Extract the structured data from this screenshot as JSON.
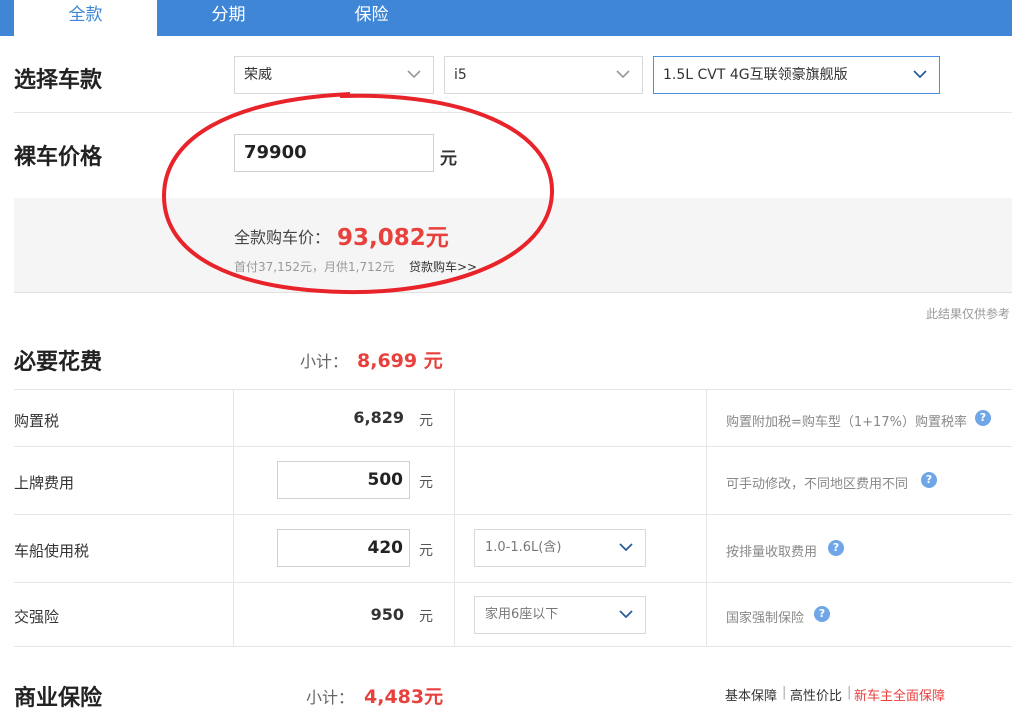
{
  "tabs": [
    {
      "label": "全款",
      "active": true
    },
    {
      "label": "分期",
      "active": false
    },
    {
      "label": "保险",
      "active": false
    }
  ],
  "select_car": {
    "title": "选择车款",
    "brand": "荣威",
    "series": "i5",
    "model": "1.5L CVT 4G互联领豪旗舰版"
  },
  "bare_price": {
    "title": "裸车价格",
    "value": "79900",
    "unit": "元"
  },
  "result": {
    "total_label": "全款购车价：",
    "total_value": "93,082元",
    "sub_info": "首付37,152元，月供1,712元",
    "loan_link": "贷款购车>>",
    "note": "此结果仅供参考"
  },
  "required_fees": {
    "title": "必要花费",
    "subtotal_label": "小计：",
    "subtotal_value": "8,699 元",
    "rows": [
      {
        "label": "购置税",
        "value": "6,829",
        "unit": "元",
        "desc": "购置附加税=购车型（1+17%）购置税率"
      },
      {
        "label": "上牌费用",
        "value": "500",
        "unit": "元",
        "desc": "可手动修改，不同地区费用不同"
      },
      {
        "label": "车船使用税",
        "value": "420",
        "unit": "元",
        "option": "1.0-1.6L(含)",
        "desc": "按排量收取费用"
      },
      {
        "label": "交强险",
        "value": "950",
        "unit": "元",
        "option": "家用6座以下",
        "desc": "国家强制保险"
      }
    ]
  },
  "commercial_insurance": {
    "title": "商业保险",
    "subtotal_label": "小计：",
    "subtotal_value": "4,483元",
    "plans": [
      "基本保障",
      "高性价比",
      "新车主全面保障"
    ],
    "separator": "|"
  },
  "icons": {
    "help": "?"
  },
  "colors": {
    "tab_blue": "#3f86d6",
    "price_red": "#e8413d",
    "circle_red": "#e8232a",
    "help_blue": "#6ea6e8"
  }
}
